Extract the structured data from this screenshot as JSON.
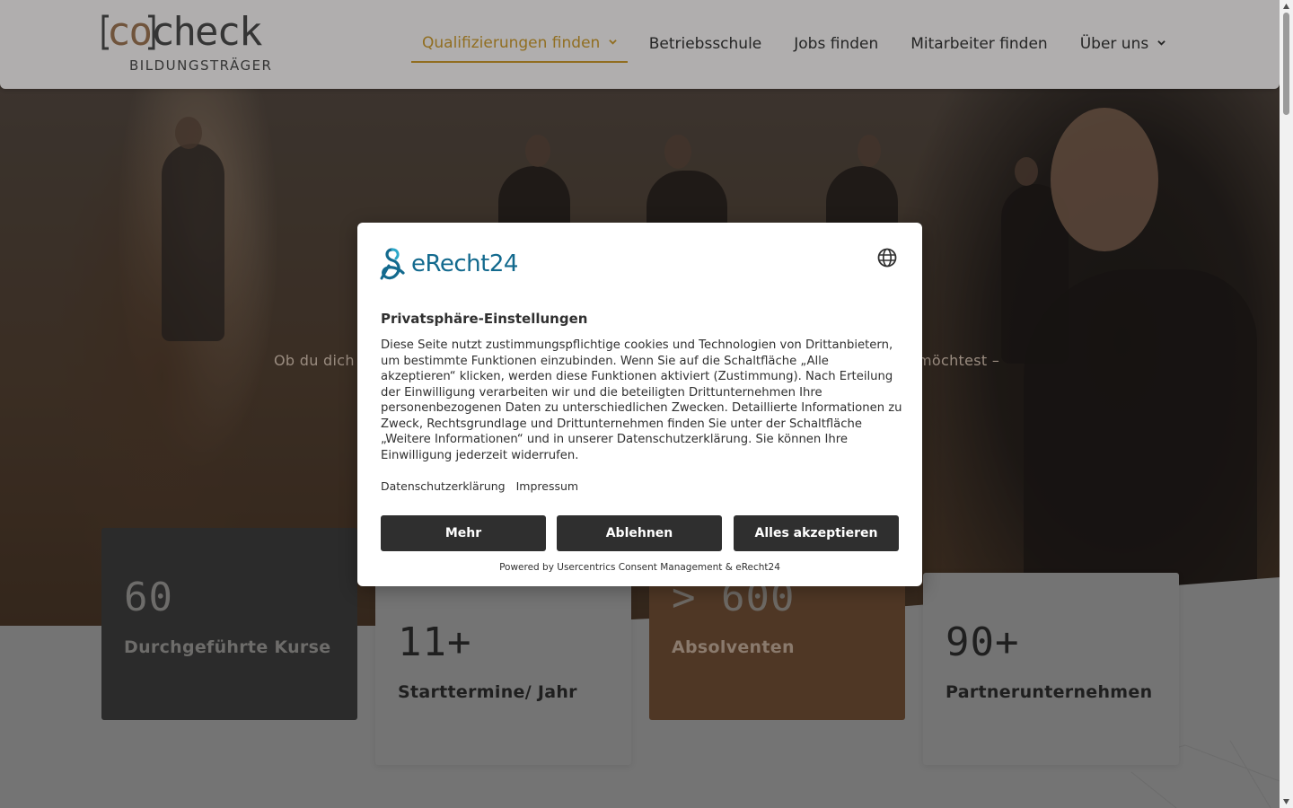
{
  "header": {
    "logo": {
      "main_prefix": "co",
      "main_suffix": "check",
      "subtitle": "BILDUNGSTRÄGER"
    },
    "nav": [
      {
        "label": "Qualifizierungen finden",
        "active": true,
        "has_dropdown": true
      },
      {
        "label": "Betriebsschule",
        "active": false,
        "has_dropdown": false
      },
      {
        "label": "Jobs finden",
        "active": false,
        "has_dropdown": false
      },
      {
        "label": "Mitarbeiter finden",
        "active": false,
        "has_dropdown": false
      },
      {
        "label": "Über uns",
        "active": false,
        "has_dropdown": true
      }
    ],
    "accent_color": "#c9992e"
  },
  "hero": {
    "subtext_left": "Ob du dich",
    "subtext_right": "möchtest –"
  },
  "stats": [
    {
      "value": "60",
      "label": "Durchgeführte Kurse"
    },
    {
      "value": "11+",
      "label": "Starttermine/ Jahr"
    },
    {
      "value": "> 600",
      "label": "Absolventen"
    },
    {
      "value": "90+",
      "label": "Partnerunternehmen"
    }
  ],
  "consent": {
    "brand": "eRecht24",
    "brand_color": "#136a8e",
    "language_icon": "globe-icon",
    "title": "Privatsphäre-Einstellungen",
    "body": "Diese Seite nutzt zustimmungspflichtige cookies und Technologien von Drittanbietern, um bestimmte Funktionen einzubinden. Wenn Sie auf die Schaltfläche „Alle akzeptieren“ klicken, werden diese Funktionen aktiviert (Zustimmung). Nach Erteilung der Einwilligung verarbeiten wir und die beteiligten Drittunternehmen Ihre personenbezogenen Daten zu unterschiedlichen Zwecken. Detaillierte Informationen zu Zweck, Rechtsgrundlage und Drittunternehmen finden Sie unter der Schaltfläche „Weitere Informationen“ und in unserer Datenschutzerklärung. Sie können Ihre Einwilligung jederzeit widerrufen.",
    "links": [
      "Datenschutzerklärung",
      "Impressum"
    ],
    "buttons": {
      "more": "Mehr",
      "deny": "Ablehnen",
      "accept": "Alles akzeptieren"
    },
    "powered_by": "Powered by Usercentrics Consent Management & eRecht24"
  }
}
